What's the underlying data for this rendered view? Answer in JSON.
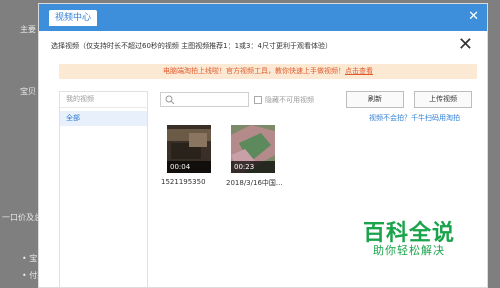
{
  "background": {
    "labels": [
      "主要",
      "宝贝",
      "一口价及总",
      "• 宝",
      "• 付款"
    ]
  },
  "dialog": {
    "title": "视频中心",
    "close_top": "✕",
    "close_main": "✕",
    "instruction": "选择视频（仅支持时长不超过60秒的视频 主图视频推荐1：1或3：4尺寸更利于观看体验）",
    "banner_text": "电脑端淘拍上线啦！官方视频工具，教你快速上手做视频！",
    "banner_link": "点击查看"
  },
  "sidebar": {
    "header": "我的视频",
    "items": [
      {
        "label": "全部"
      }
    ]
  },
  "toolbar": {
    "search_placeholder": "",
    "hide_unavailable_label": "隐藏不可用视频",
    "refresh_label": "刷新",
    "upload_label": "上传视频",
    "help_link": "视频不会拍？千牛扫码用淘拍"
  },
  "videos": [
    {
      "duration": "00:04",
      "name": "1521195350"
    },
    {
      "duration": "00:23",
      "name": "2018/3/16中国..."
    }
  ],
  "watermark": {
    "title": "百科全说",
    "subtitle": "助你轻松解决"
  },
  "colors": {
    "accent": "#3d8fdc",
    "banner_bg": "#fbe9d4",
    "banner_text": "#e05a2b",
    "link": "#2f7fd3",
    "watermark": "#19a34a"
  }
}
